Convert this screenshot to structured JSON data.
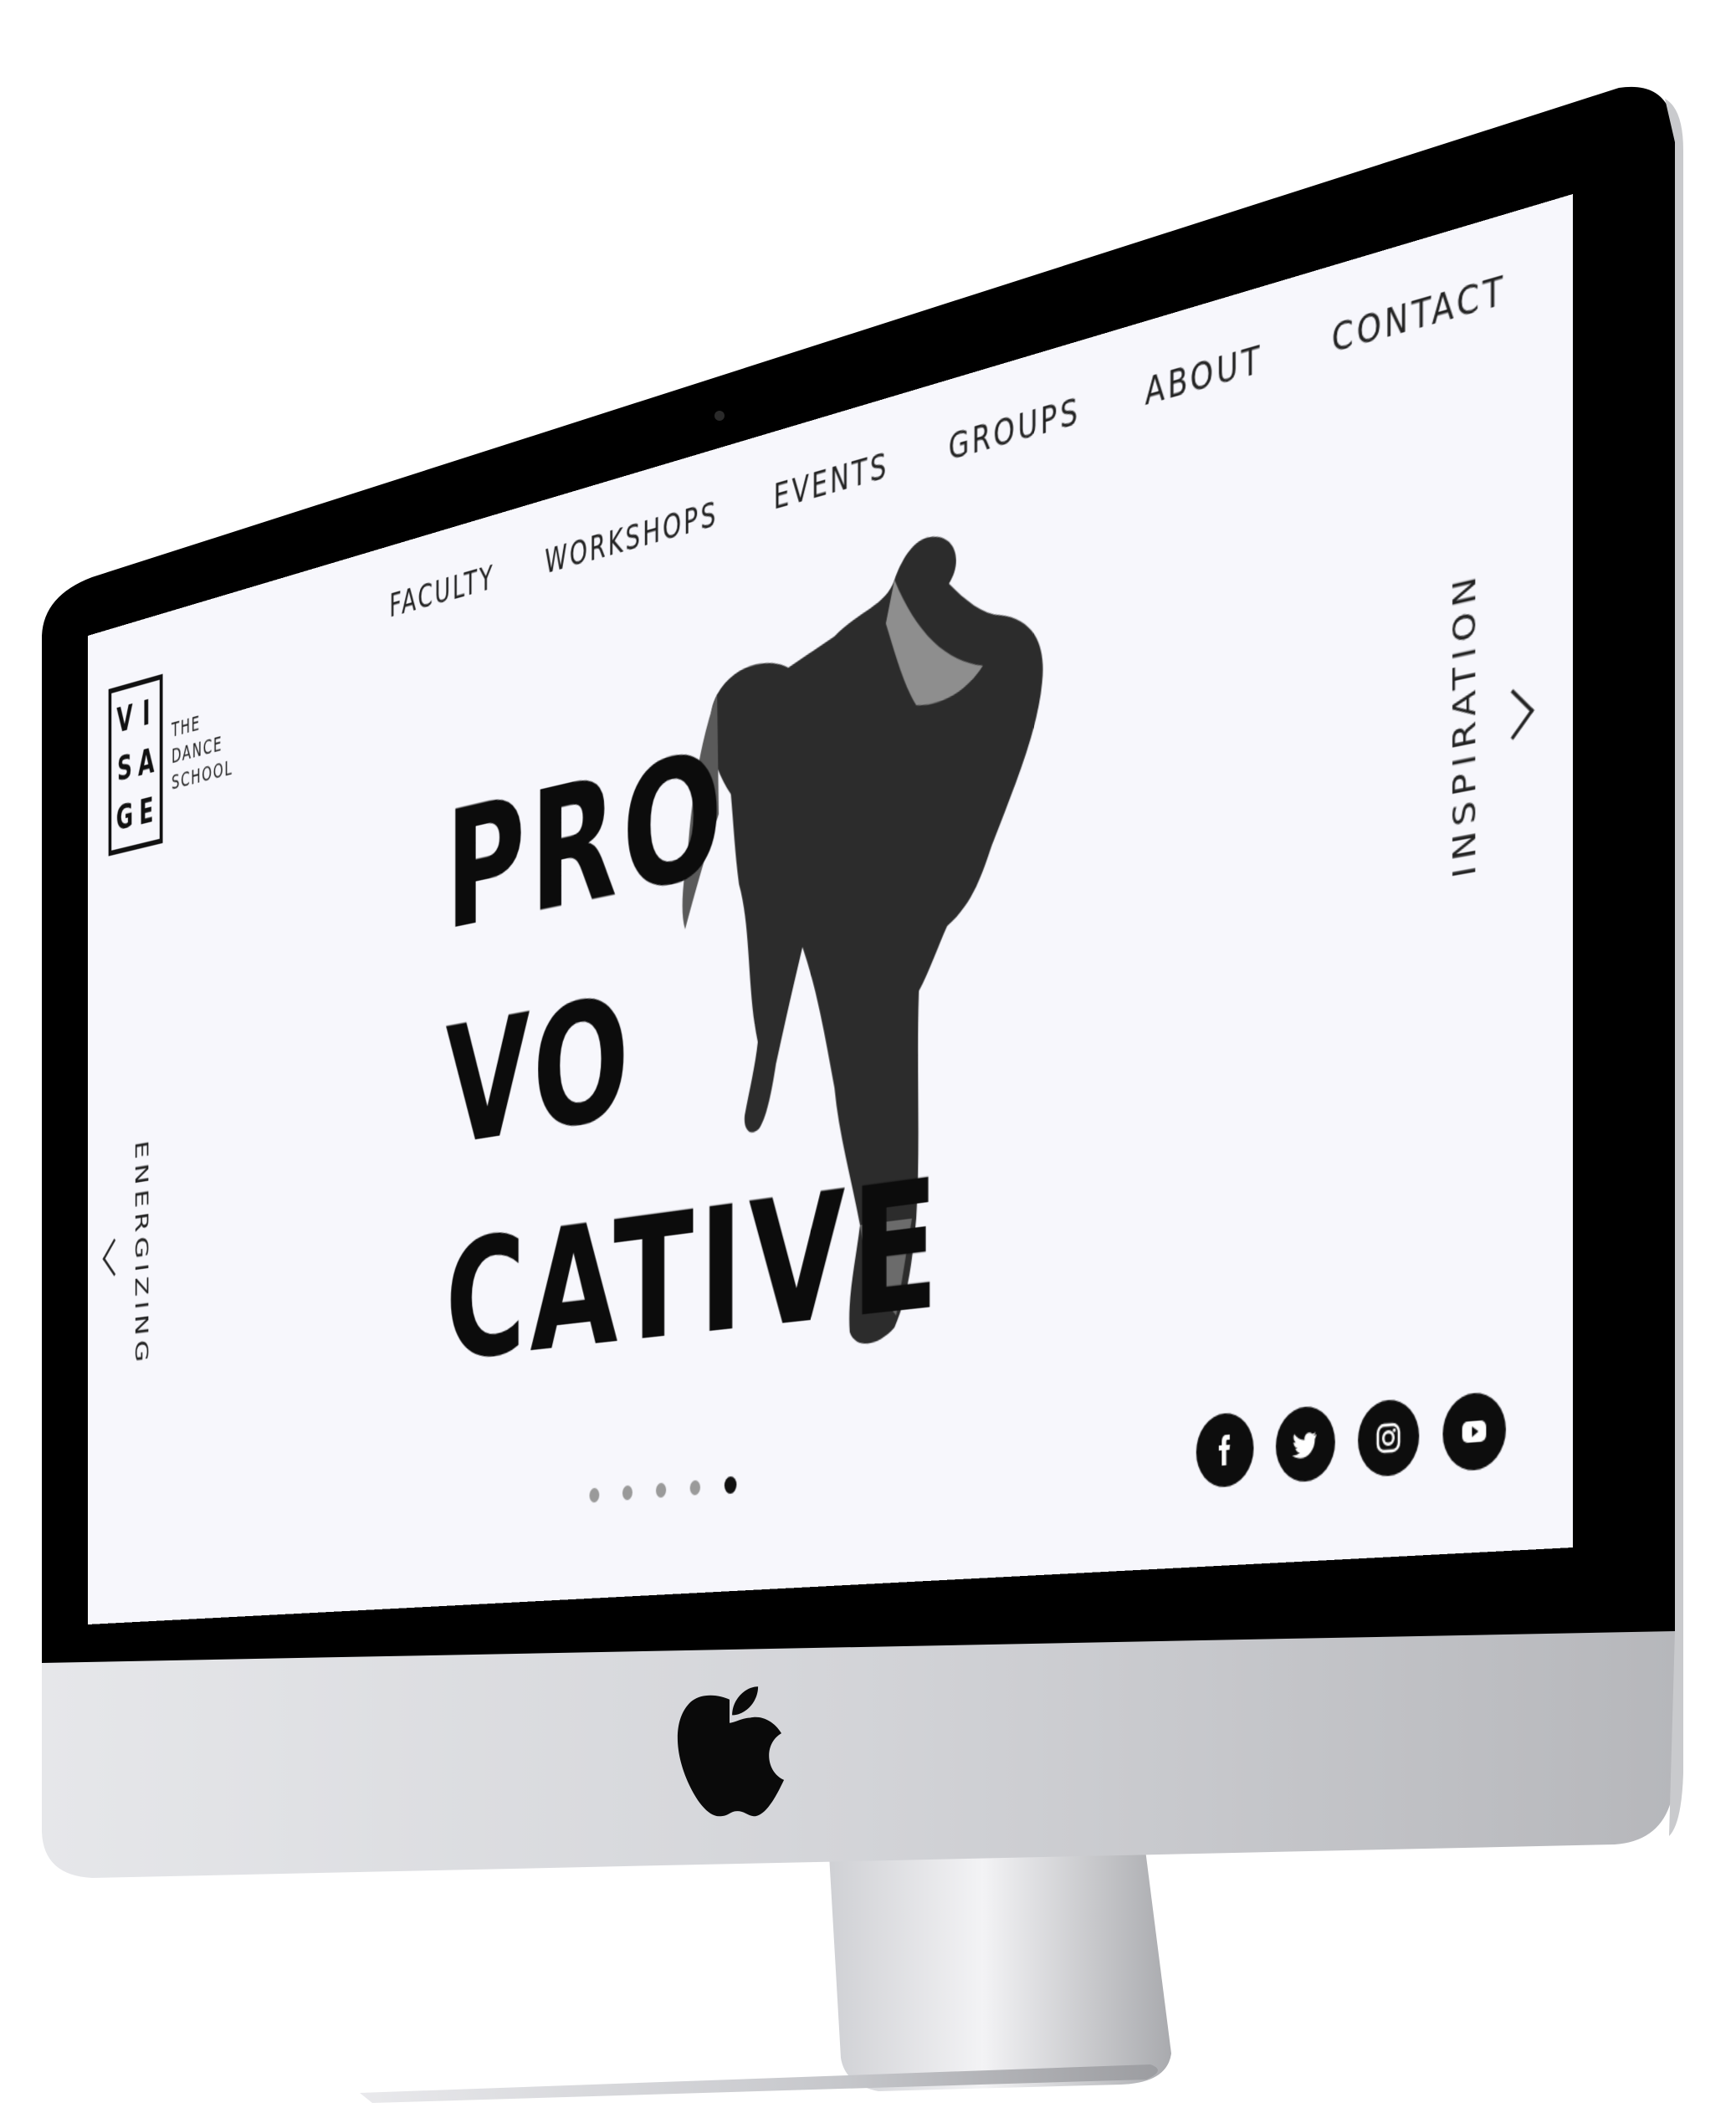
{
  "nav": {
    "items": [
      {
        "label": "FACULTY"
      },
      {
        "label": "WORKSHOPS"
      },
      {
        "label": "EVENTS"
      },
      {
        "label": "GROUPS"
      },
      {
        "label": "ABOUT"
      },
      {
        "label": "CONTACT"
      }
    ]
  },
  "logo": {
    "letters": [
      "V",
      "I",
      "S",
      "A",
      "G",
      "E"
    ],
    "subtitle_lines": [
      "THE",
      "DANCE",
      "SCHOOL"
    ]
  },
  "hero": {
    "lines": [
      "PRO",
      "VO",
      "CATIVE"
    ]
  },
  "side_nav": {
    "next_label": "INSPIRATION",
    "prev_label": "ENERGIZING"
  },
  "slider": {
    "count": 5,
    "active_index": 4
  },
  "social": [
    {
      "icon": "facebook-icon"
    },
    {
      "icon": "twitter-icon"
    },
    {
      "icon": "instagram-icon"
    },
    {
      "icon": "youtube-icon"
    }
  ],
  "colors": {
    "screen_bg": "#f7f7fc",
    "text": "#0c0c0c",
    "bezel": "#000000",
    "chin": "#d9dadd"
  }
}
